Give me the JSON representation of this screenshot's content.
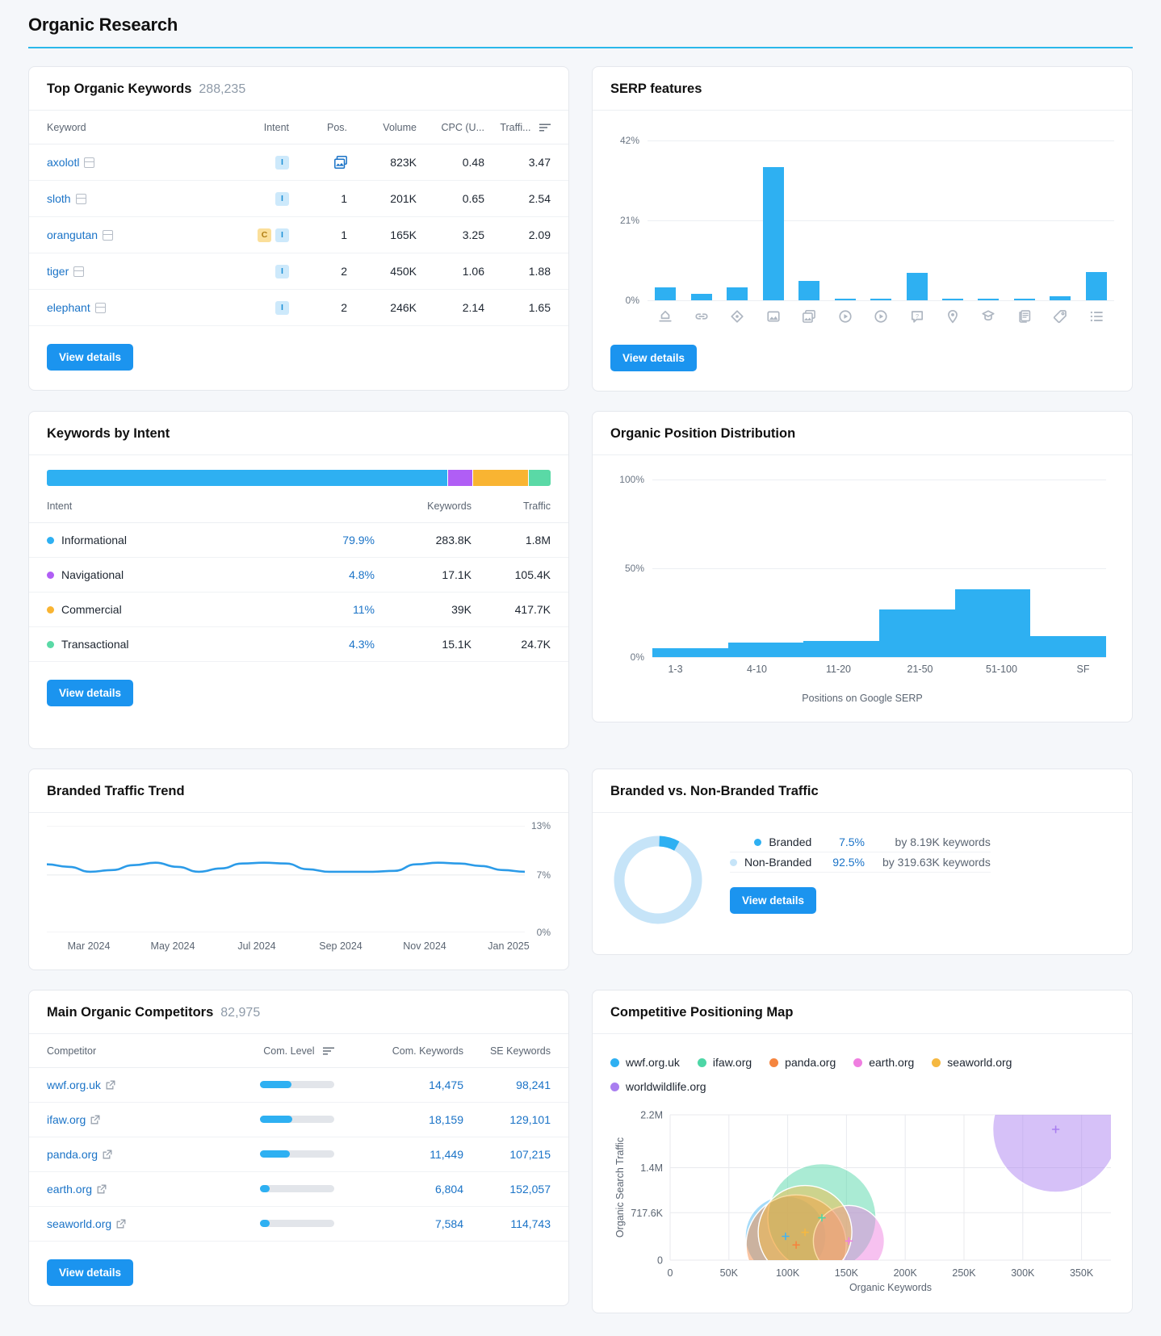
{
  "page": {
    "title": "Organic Research",
    "accent": "#2bb8ea"
  },
  "top_keywords": {
    "title": "Top Organic Keywords",
    "count": "288,235",
    "columns": [
      "Keyword",
      "Intent",
      "Pos.",
      "Volume",
      "CPC (U...",
      "Traffi..."
    ],
    "sort_icon": "sort-icon",
    "rows": [
      {
        "keyword": "axolotl",
        "intent": [
          "I"
        ],
        "pos": "serp-feature-icon",
        "volume": "823K",
        "cpc": "0.48",
        "traffic": "3.47"
      },
      {
        "keyword": "sloth",
        "intent": [
          "I"
        ],
        "pos": "1",
        "volume": "201K",
        "cpc": "0.65",
        "traffic": "2.54"
      },
      {
        "keyword": "orangutan",
        "intent": [
          "C",
          "I"
        ],
        "pos": "1",
        "volume": "165K",
        "cpc": "3.25",
        "traffic": "2.09"
      },
      {
        "keyword": "tiger",
        "intent": [
          "I"
        ],
        "pos": "2",
        "volume": "450K",
        "cpc": "1.06",
        "traffic": "1.88"
      },
      {
        "keyword": "elephant",
        "intent": [
          "I"
        ],
        "pos": "2",
        "volume": "246K",
        "cpc": "2.14",
        "traffic": "1.65"
      }
    ],
    "view_details": "View details"
  },
  "serp_features": {
    "title": "SERP features",
    "view_details": "View details",
    "chart_data": {
      "type": "bar",
      "title": "SERP features",
      "xlabel": "",
      "ylabel": "",
      "ylim": [
        0,
        42
      ],
      "yticks": [
        "0%",
        "21%",
        "42%"
      ],
      "grid": true,
      "categories": [
        "featured-snippet-icon",
        "sitelinks-icon",
        "knowledge-panel-icon",
        "image-icon",
        "image-pack-icon",
        "video-icon",
        "video-carousel-icon",
        "faq-icon",
        "local-pack-icon",
        "instant-answer-icon",
        "reviews-icon",
        "shopping-icon",
        "people-also-ask-icon"
      ],
      "values": [
        3.5,
        1.7,
        3.5,
        35,
        5.2,
        0.4,
        0.4,
        7.3,
        0.4,
        0.4,
        0.4,
        1.0,
        7.5
      ],
      "color": "#2eb0f2"
    }
  },
  "keywords_by_intent": {
    "title": "Keywords by Intent",
    "columns": [
      "Intent",
      "",
      "Keywords",
      "Traffic"
    ],
    "view_details": "View details",
    "chart_data": {
      "type": "bar",
      "title": "Keywords by Intent",
      "categories": [
        "Informational",
        "Navigational",
        "Commercial",
        "Transactional"
      ],
      "values": [
        79.9,
        4.8,
        11,
        4.3
      ],
      "colors": [
        "#2eb0f2",
        "#b05ef5",
        "#f9b432",
        "#5ad9a6"
      ]
    },
    "rows": [
      {
        "intent": "Informational",
        "color": "#2eb0f2",
        "pct": "79.9%",
        "keywords": "283.8K",
        "traffic": "1.8M"
      },
      {
        "intent": "Navigational",
        "color": "#b05ef5",
        "pct": "4.8%",
        "keywords": "17.1K",
        "traffic": "105.4K"
      },
      {
        "intent": "Commercial",
        "color": "#f9b432",
        "pct": "11%",
        "keywords": "39K",
        "traffic": "417.7K"
      },
      {
        "intent": "Transactional",
        "color": "#5ad9a6",
        "pct": "4.3%",
        "keywords": "15.1K",
        "traffic": "24.7K"
      }
    ]
  },
  "position_distribution": {
    "title": "Organic Position Distribution",
    "caption": "Positions on Google SERP",
    "chart_data": {
      "type": "bar",
      "title": "Organic Position Distribution",
      "xlabel": "Positions on Google SERP",
      "ylabel": "",
      "ylim": [
        0,
        100
      ],
      "yticks": [
        "0%",
        "50%",
        "100%"
      ],
      "grid": true,
      "categories": [
        "1-3",
        "4-10",
        "11-20",
        "21-50",
        "51-100",
        "SF"
      ],
      "values": [
        5,
        8,
        9,
        27,
        38,
        12
      ],
      "color": "#2eb0f2"
    }
  },
  "branded_trend": {
    "title": "Branded Traffic Trend",
    "chart_data": {
      "type": "line",
      "title": "Branded Traffic Trend",
      "ylim": [
        0,
        13
      ],
      "yticks": [
        "0%",
        "7%",
        "13%"
      ],
      "grid": true,
      "xticks": [
        "Mar 2024",
        "May 2024",
        "Jul 2024",
        "Sep 2024",
        "Nov 2024",
        "Jan 2025"
      ],
      "series": [
        {
          "name": "Branded traffic %",
          "color": "#2b9be8",
          "values": [
            8.3,
            8.0,
            7.4,
            7.6,
            8.2,
            8.5,
            8.0,
            7.4,
            7.8,
            8.4,
            8.5,
            8.4,
            7.7,
            7.4,
            7.4,
            7.4,
            7.5,
            8.3,
            8.5,
            8.4,
            8.1,
            7.6,
            7.4
          ]
        }
      ]
    }
  },
  "branded_vs_nonbranded": {
    "title": "Branded vs. Non-Branded Traffic",
    "view_details": "View details",
    "chart_data": {
      "type": "pie",
      "title": "Branded vs. Non-Branded Traffic",
      "labels": [
        "Branded",
        "Non-Branded"
      ],
      "values": [
        7.5,
        92.5
      ],
      "colors": [
        "#2eb0f2",
        "#c6e4f8"
      ]
    },
    "rows": [
      {
        "label": "Branded",
        "color": "#2eb0f2",
        "pct": "7.5%",
        "by": "by 8.19K keywords"
      },
      {
        "label": "Non-Branded",
        "color": "#c6e4f8",
        "pct": "92.5%",
        "by": "by 319.63K keywords"
      }
    ]
  },
  "competitors": {
    "title": "Main Organic Competitors",
    "count": "82,975",
    "columns": [
      "Competitor",
      "Com. Level",
      "Com. Keywords",
      "SE Keywords"
    ],
    "view_details": "View details",
    "rows": [
      {
        "domain": "wwf.org.uk",
        "level": 42,
        "com_keywords": "14,475",
        "se_keywords": "98,241"
      },
      {
        "domain": "ifaw.org",
        "level": 44,
        "com_keywords": "18,159",
        "se_keywords": "129,101"
      },
      {
        "domain": "panda.org",
        "level": 40,
        "com_keywords": "11,449",
        "se_keywords": "107,215"
      },
      {
        "domain": "earth.org",
        "level": 13,
        "com_keywords": "6,804",
        "se_keywords": "152,057"
      },
      {
        "domain": "seaworld.org",
        "level": 13,
        "com_keywords": "7,584",
        "se_keywords": "114,743"
      }
    ]
  },
  "positioning_map": {
    "title": "Competitive Positioning Map",
    "chart_data": {
      "type": "scatter",
      "title": "Competitive Positioning Map",
      "xlabel": "Organic Keywords",
      "ylabel": "Organic Search Traffic",
      "xticks": [
        "0",
        "50K",
        "100K",
        "150K",
        "200K",
        "250K",
        "300K",
        "350K"
      ],
      "yticks": [
        "0",
        "717.6K",
        "1.4M",
        "2.2M"
      ],
      "xlim": [
        0,
        375000
      ],
      "ylim": [
        0,
        2200000
      ],
      "grid": true,
      "points": [
        {
          "name": "wwf.org.uk",
          "color": "#44b3f0",
          "x": 98241,
          "y": 360000,
          "r": 50
        },
        {
          "name": "ifaw.org",
          "color": "#4dd6a6",
          "x": 129101,
          "y": 640000,
          "r": 67
        },
        {
          "name": "panda.org",
          "color": "#f5853f",
          "x": 107215,
          "y": 230000,
          "r": 62
        },
        {
          "name": "earth.org",
          "color": "#ef7ee0",
          "x": 152057,
          "y": 290000,
          "r": 44
        },
        {
          "name": "seaworld.org",
          "color": "#f5b841",
          "x": 114743,
          "y": 420000,
          "r": 58
        },
        {
          "name": "worldwildlife.org",
          "color": "#a97ef0",
          "x": 328000,
          "y": 1980000,
          "r": 78
        }
      ]
    },
    "legend": [
      {
        "name": "wwf.org.uk",
        "color": "#2eb0f2"
      },
      {
        "name": "ifaw.org",
        "color": "#4dd6a6"
      },
      {
        "name": "panda.org",
        "color": "#f5853f"
      },
      {
        "name": "earth.org",
        "color": "#ef7ee0"
      },
      {
        "name": "seaworld.org",
        "color": "#f5b841"
      },
      {
        "name": "worldwildlife.org",
        "color": "#a97ef0"
      }
    ]
  }
}
